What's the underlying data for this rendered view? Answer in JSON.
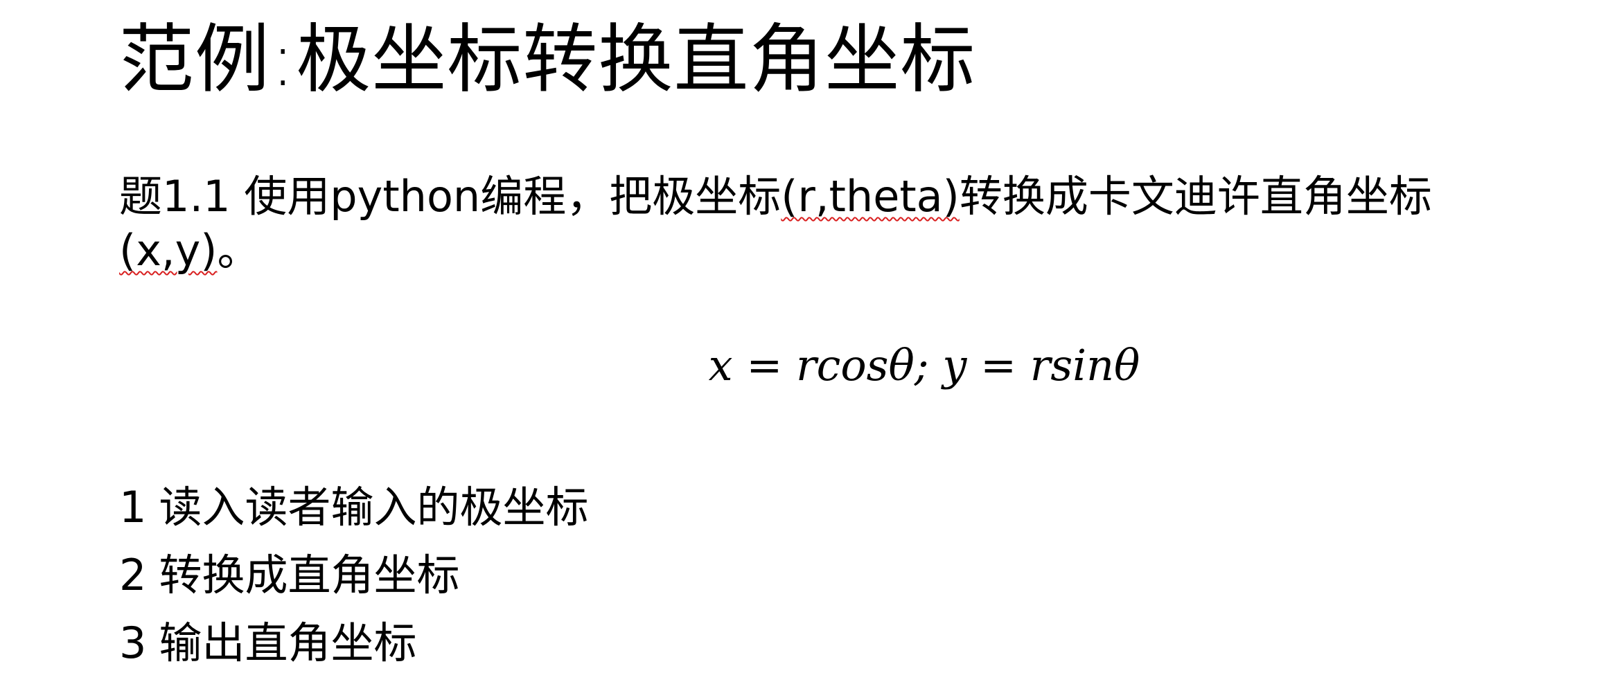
{
  "slide": {
    "title": "范例:极坐标转换直角坐标",
    "problem": {
      "line1_prefix": "题1.1 使用python编程，把极坐标",
      "line1_flagged": "(r,theta)",
      "line1_suffix": "转换成卡文迪许直角坐标",
      "line2_flagged": "(x,y)",
      "line2_suffix": "。"
    },
    "formula": "x = rcosθ; y = rsinθ",
    "steps": [
      {
        "num": "1",
        "text": "读入读者输入的极坐标"
      },
      {
        "num": "2",
        "text": "转换成直角坐标"
      },
      {
        "num": "3",
        "text": "输出直角坐标"
      }
    ],
    "colors": {
      "text": "#000000",
      "background": "#ffffff",
      "spellcheck_underline": "#d92020"
    }
  }
}
